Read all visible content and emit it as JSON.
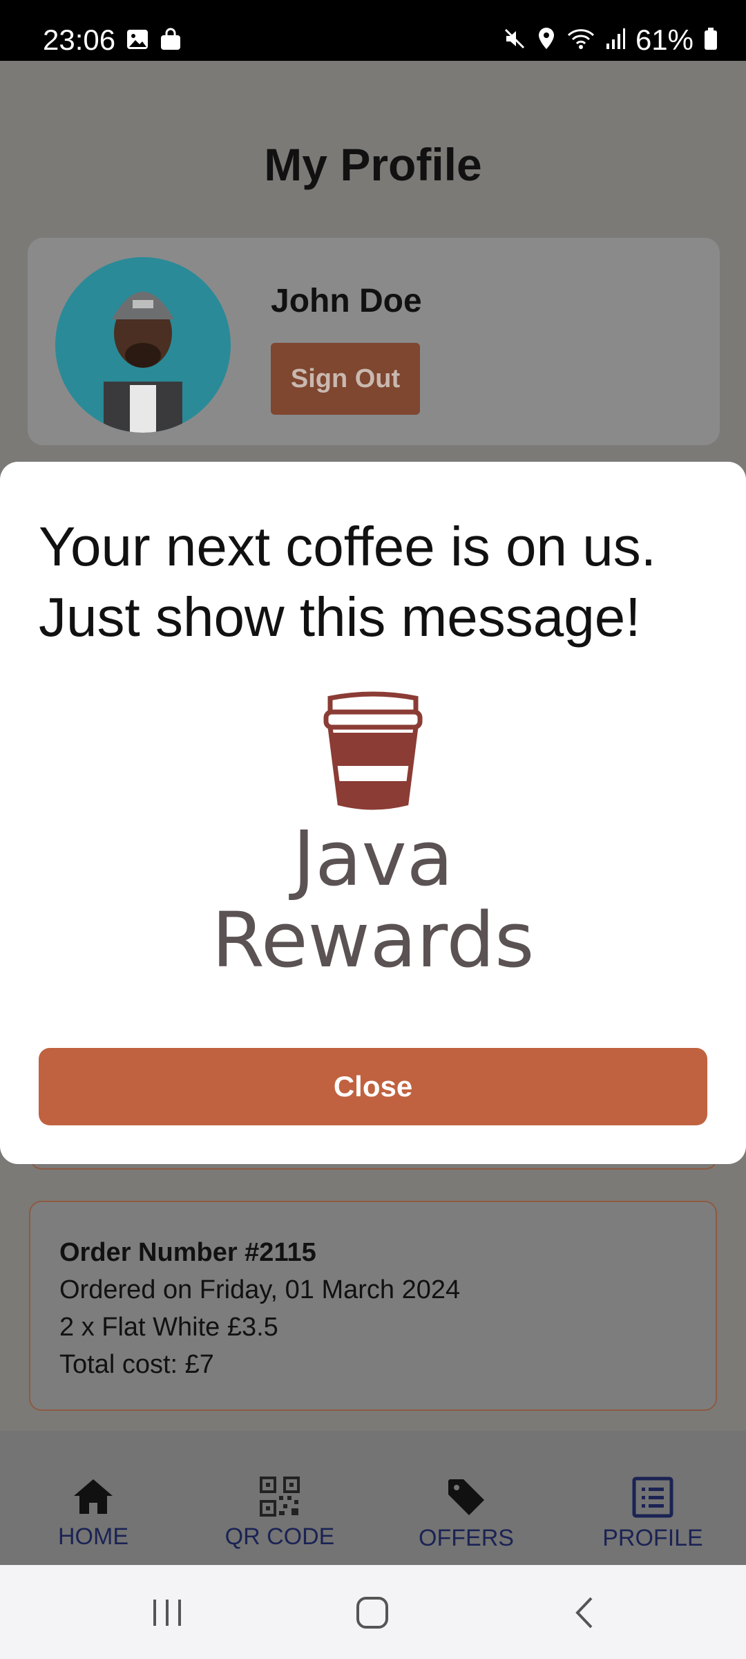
{
  "status_bar": {
    "time": "23:06",
    "battery": "61%",
    "icons": [
      "gallery-icon",
      "shopping-bag-icon",
      "mute-icon",
      "location-icon",
      "wifi-icon",
      "signal-icon",
      "battery-icon"
    ]
  },
  "page": {
    "title": "My Profile"
  },
  "profile": {
    "name": "John Doe",
    "sign_out_label": "Sign Out"
  },
  "order": {
    "title": "Order Number #2115",
    "date": "Ordered on Friday, 01 March 2024",
    "item": "2 x Flat White £3.5",
    "total": "Total cost: £7"
  },
  "bottom_nav": {
    "items": [
      {
        "label": "HOME",
        "icon": "home-icon"
      },
      {
        "label": "QR CODE",
        "icon": "qr-code-icon"
      },
      {
        "label": "OFFERS",
        "icon": "tag-icon"
      },
      {
        "label": "PROFILE",
        "icon": "list-icon"
      }
    ]
  },
  "modal": {
    "line1": "Your next coffee is on us.",
    "line2": "Just show this message!",
    "logo_line1": "Java",
    "logo_line2": "Rewards",
    "close_label": "Close"
  },
  "colors": {
    "accent": "#c06240",
    "nav_text": "#1b2354",
    "logo_cup": "#8b3c35",
    "logo_text": "#5a5253"
  }
}
